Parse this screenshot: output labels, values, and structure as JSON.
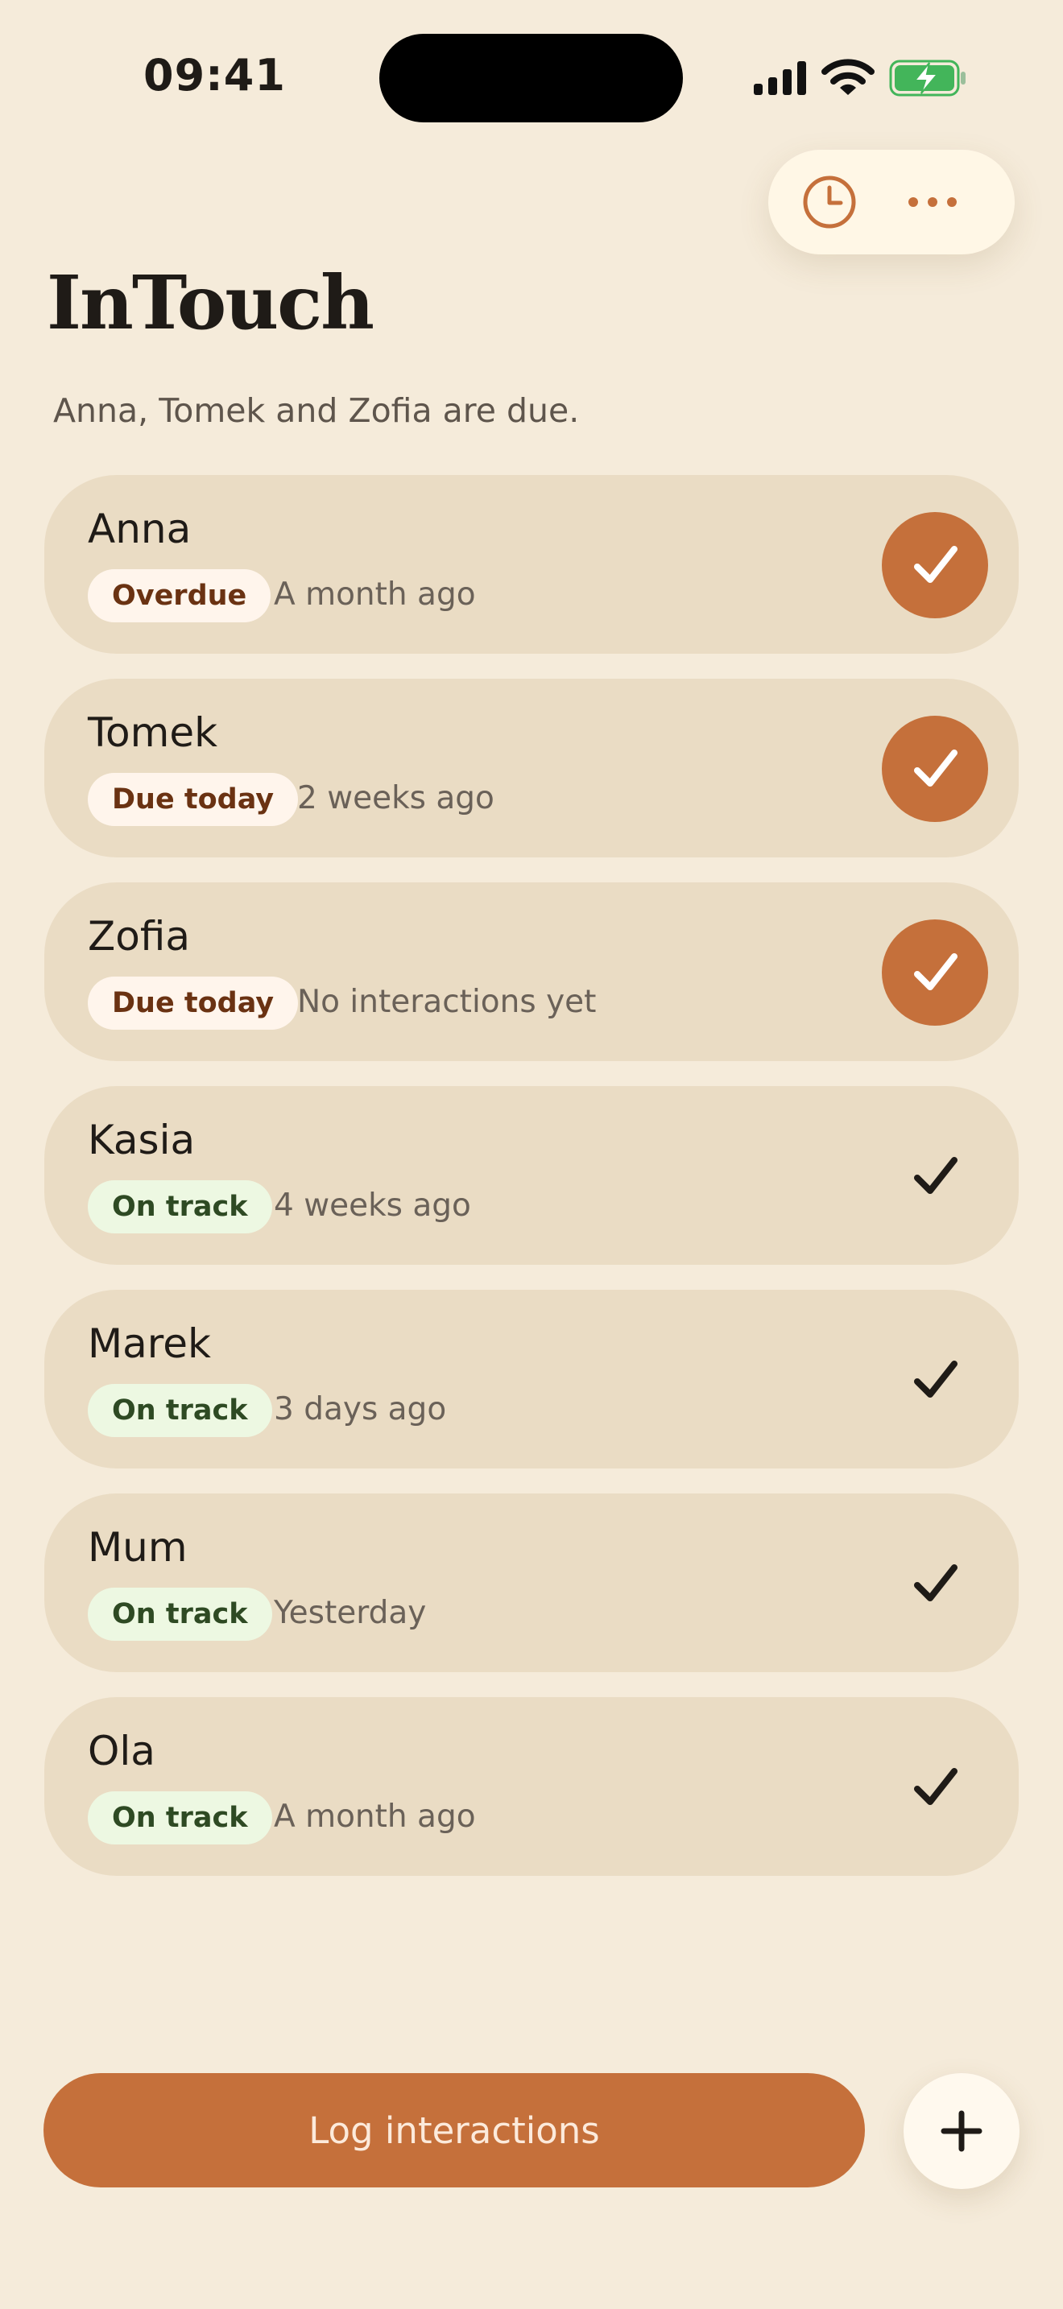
{
  "status_bar": {
    "time": "09:41"
  },
  "app": {
    "title": "InTouch",
    "subtitle": "Anna, Tomek and Zofia are due."
  },
  "toolbar": {
    "history_icon": "clock-icon",
    "more_icon": "ellipsis-icon"
  },
  "colors": {
    "background": "#F5EBDA",
    "card": "#EADCC4",
    "accent": "#C5703B",
    "due_badge_bg": "#FFF5EC",
    "due_badge_text": "#6A3212",
    "ontrack_badge_bg": "#EDF8E2",
    "ontrack_badge_text": "#2E4A23"
  },
  "contacts": [
    {
      "name": "Anna",
      "status": "Overdue",
      "last": "A month ago",
      "due": true
    },
    {
      "name": "Tomek",
      "status": "Due today",
      "last": "2 weeks ago",
      "due": true
    },
    {
      "name": "Zofia",
      "status": "Due today",
      "last": "No interactions yet",
      "due": true
    },
    {
      "name": "Kasia",
      "status": "On track",
      "last": "4 weeks ago",
      "due": false
    },
    {
      "name": "Marek",
      "status": "On track",
      "last": "3 days ago",
      "due": false
    },
    {
      "name": "Mum",
      "status": "On track",
      "last": "Yesterday",
      "due": false
    },
    {
      "name": "Ola",
      "status": "On track",
      "last": "A month ago",
      "due": false
    }
  ],
  "footer": {
    "log_label": "Log interactions",
    "add_icon": "plus-icon"
  }
}
